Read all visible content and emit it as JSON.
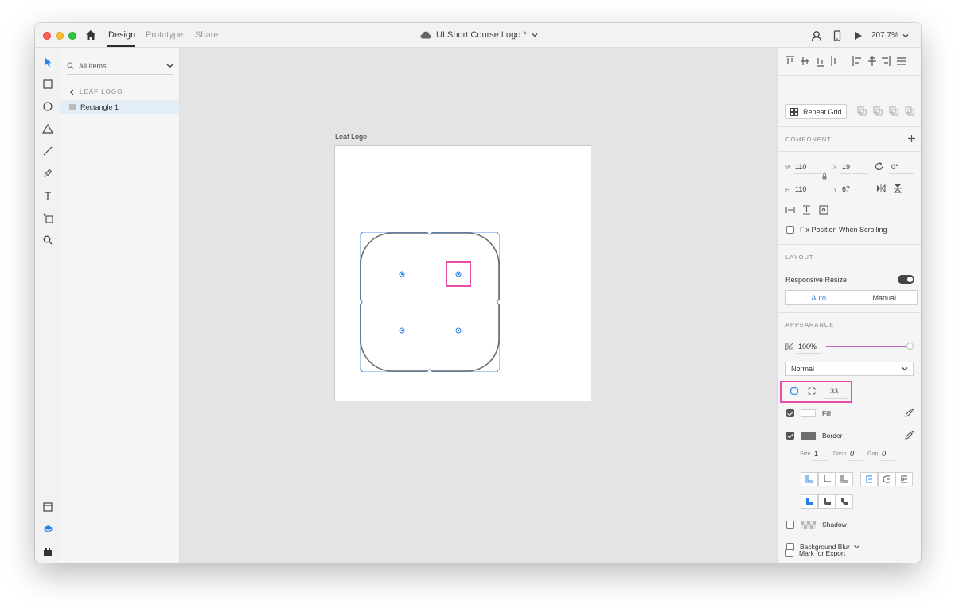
{
  "titlebar": {
    "tabs": [
      "Design",
      "Prototype",
      "Share"
    ],
    "active_tab": "Design",
    "document_title": "UI Short Course Logo *",
    "zoom": "207.7%"
  },
  "layers": {
    "filter_label": "All Items",
    "breadcrumb": "LEAF LOGO",
    "items": [
      {
        "label": "Rectangle 1"
      }
    ]
  },
  "canvas": {
    "artboard_label": "Leaf Logo"
  },
  "inspector": {
    "repeat_grid_label": "Repeat Grid",
    "component_title": "COMPONENT",
    "transform": {
      "w_label": "W",
      "w": "110",
      "x_label": "X",
      "x": "19",
      "h_label": "H",
      "h": "110",
      "y_label": "Y",
      "y": "67",
      "rotation": "0°"
    },
    "fix_position_label": "Fix Position When Scrolling",
    "layout_title": "LAYOUT",
    "responsive_resize_label": "Responsive Resize",
    "responsive_resize_on": true,
    "resize_modes": [
      "Auto",
      "Manual"
    ],
    "active_resize_mode": "Auto",
    "appearance_title": "APPEARANCE",
    "opacity": "100%",
    "opacity_fraction": 1.0,
    "blend_mode": "Normal",
    "corner_radius": "33",
    "fill_label": "Fill",
    "fill_color": "#ffffff",
    "fill_checked": true,
    "border_label": "Border",
    "border_color": "#6e6e6e",
    "border_checked": true,
    "border_size_label": "Size",
    "border_size": "1",
    "dash_label": "Dash",
    "dash": "0",
    "gap_label": "Gap",
    "gap": "0",
    "shadow_label": "Shadow",
    "shadow_checked": false,
    "background_blur_label": "Background Blur",
    "background_blur_checked": false,
    "mark_for_export_label": "Mark for Export",
    "mark_for_export_checked": false
  },
  "colors": {
    "accent": "#2680eb",
    "highlight": "#e84ea8",
    "selection": "#2680eb",
    "opacity_slider": "#c266c2"
  },
  "icons": {
    "toolbar": [
      "select-icon",
      "rectangle-icon",
      "ellipse-icon",
      "triangle-icon",
      "line-icon",
      "pen-icon",
      "text-icon",
      "artboard-icon",
      "zoom-icon"
    ],
    "toolbar_bottom": [
      "assets-icon",
      "layers-icon",
      "plugins-icon"
    ],
    "title_right": [
      "user-icon",
      "mobile-preview-icon",
      "play-icon"
    ]
  }
}
